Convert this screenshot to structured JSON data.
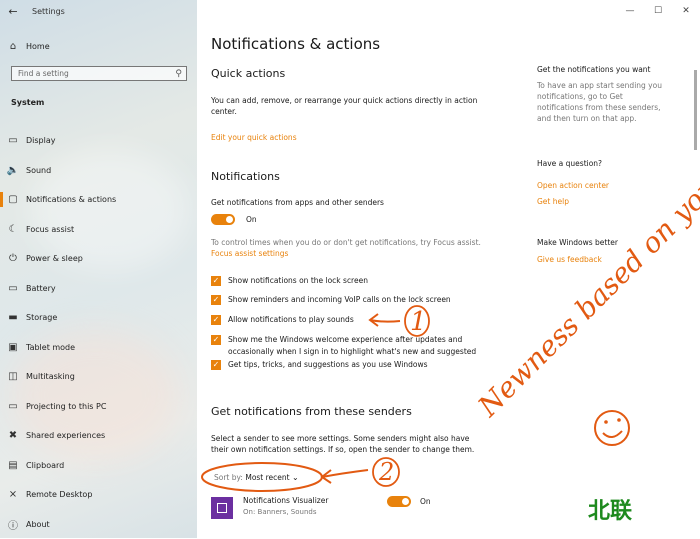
{
  "window": {
    "app_title": "Settings",
    "controls": {
      "minimize": "—",
      "maximize": "☐",
      "close": "✕"
    }
  },
  "sidebar": {
    "home_label": "Home",
    "search_placeholder": "Find a setting",
    "section_header": "System",
    "items": [
      {
        "label": "Display",
        "icon": "monitor-icon",
        "glyph": "▭"
      },
      {
        "label": "Sound",
        "icon": "speaker-icon",
        "glyph": "🔈"
      },
      {
        "label": "Notifications & actions",
        "icon": "notification-icon",
        "glyph": "▢",
        "selected": true
      },
      {
        "label": "Focus assist",
        "icon": "moon-icon",
        "glyph": "☾"
      },
      {
        "label": "Power & sleep",
        "icon": "power-icon",
        "glyph": "⏻"
      },
      {
        "label": "Battery",
        "icon": "battery-icon",
        "glyph": "▭"
      },
      {
        "label": "Storage",
        "icon": "storage-icon",
        "glyph": "▬"
      },
      {
        "label": "Tablet mode",
        "icon": "tablet-icon",
        "glyph": "▣"
      },
      {
        "label": "Multitasking",
        "icon": "multitask-icon",
        "glyph": "◫"
      },
      {
        "label": "Projecting to this PC",
        "icon": "project-icon",
        "glyph": "▭"
      },
      {
        "label": "Shared experiences",
        "icon": "share-icon",
        "glyph": "✖"
      },
      {
        "label": "Clipboard",
        "icon": "clipboard-icon",
        "glyph": "▤"
      },
      {
        "label": "Remote Desktop",
        "icon": "remote-icon",
        "glyph": "⨯"
      },
      {
        "label": "About",
        "icon": "info-icon",
        "glyph": "ⓘ"
      }
    ]
  },
  "main": {
    "page_title": "Notifications & actions",
    "quick_actions": {
      "heading": "Quick actions",
      "description": "You can add, remove, or rearrange your quick actions directly in action center.",
      "link": "Edit your quick actions"
    },
    "notifications": {
      "heading": "Notifications",
      "toggle_label": "Get notifications from apps and other senders",
      "toggle_state": "On",
      "focus_text": "To control times when you do or don't get notifications, try Focus assist.",
      "focus_link": "Focus assist settings",
      "checkboxes": [
        "Show notifications on the lock screen",
        "Show reminders and incoming VoIP calls on the lock screen",
        "Allow notifications to play sounds",
        "Show me the Windows welcome experience after updates and occasionally when I sign in to highlight what's new and suggested",
        "Get tips, tricks, and suggestions as you use Windows"
      ]
    },
    "senders": {
      "heading": "Get notifications from these senders",
      "description": "Select a sender to see more settings. Some senders might also have their own notification settings. If so, open the sender to change them.",
      "sort_label": "Sort by:",
      "sort_value": "Most recent",
      "app": {
        "name": "Notifications Visualizer",
        "sub": "On: Banners, Sounds",
        "state": "On"
      }
    }
  },
  "right_panel": {
    "get_notif_heading": "Get the notifications you want",
    "get_notif_text": "To have an app start sending you notifications, go to Get notifications from these senders, and then turn on that app.",
    "question_heading": "Have a question?",
    "link_action_center": "Open action center",
    "link_help": "Get help",
    "better_heading": "Make Windows better",
    "link_feedback": "Give us feedback"
  },
  "annotations": {
    "note": "Newness based on your feedback",
    "num1": "1",
    "num2": "2",
    "watermark": "北联"
  },
  "colors": {
    "accent": "#e8820c",
    "annotation": "#e25a12",
    "app_tile": "#6b2fa0",
    "watermark": "#1e8a1e"
  }
}
